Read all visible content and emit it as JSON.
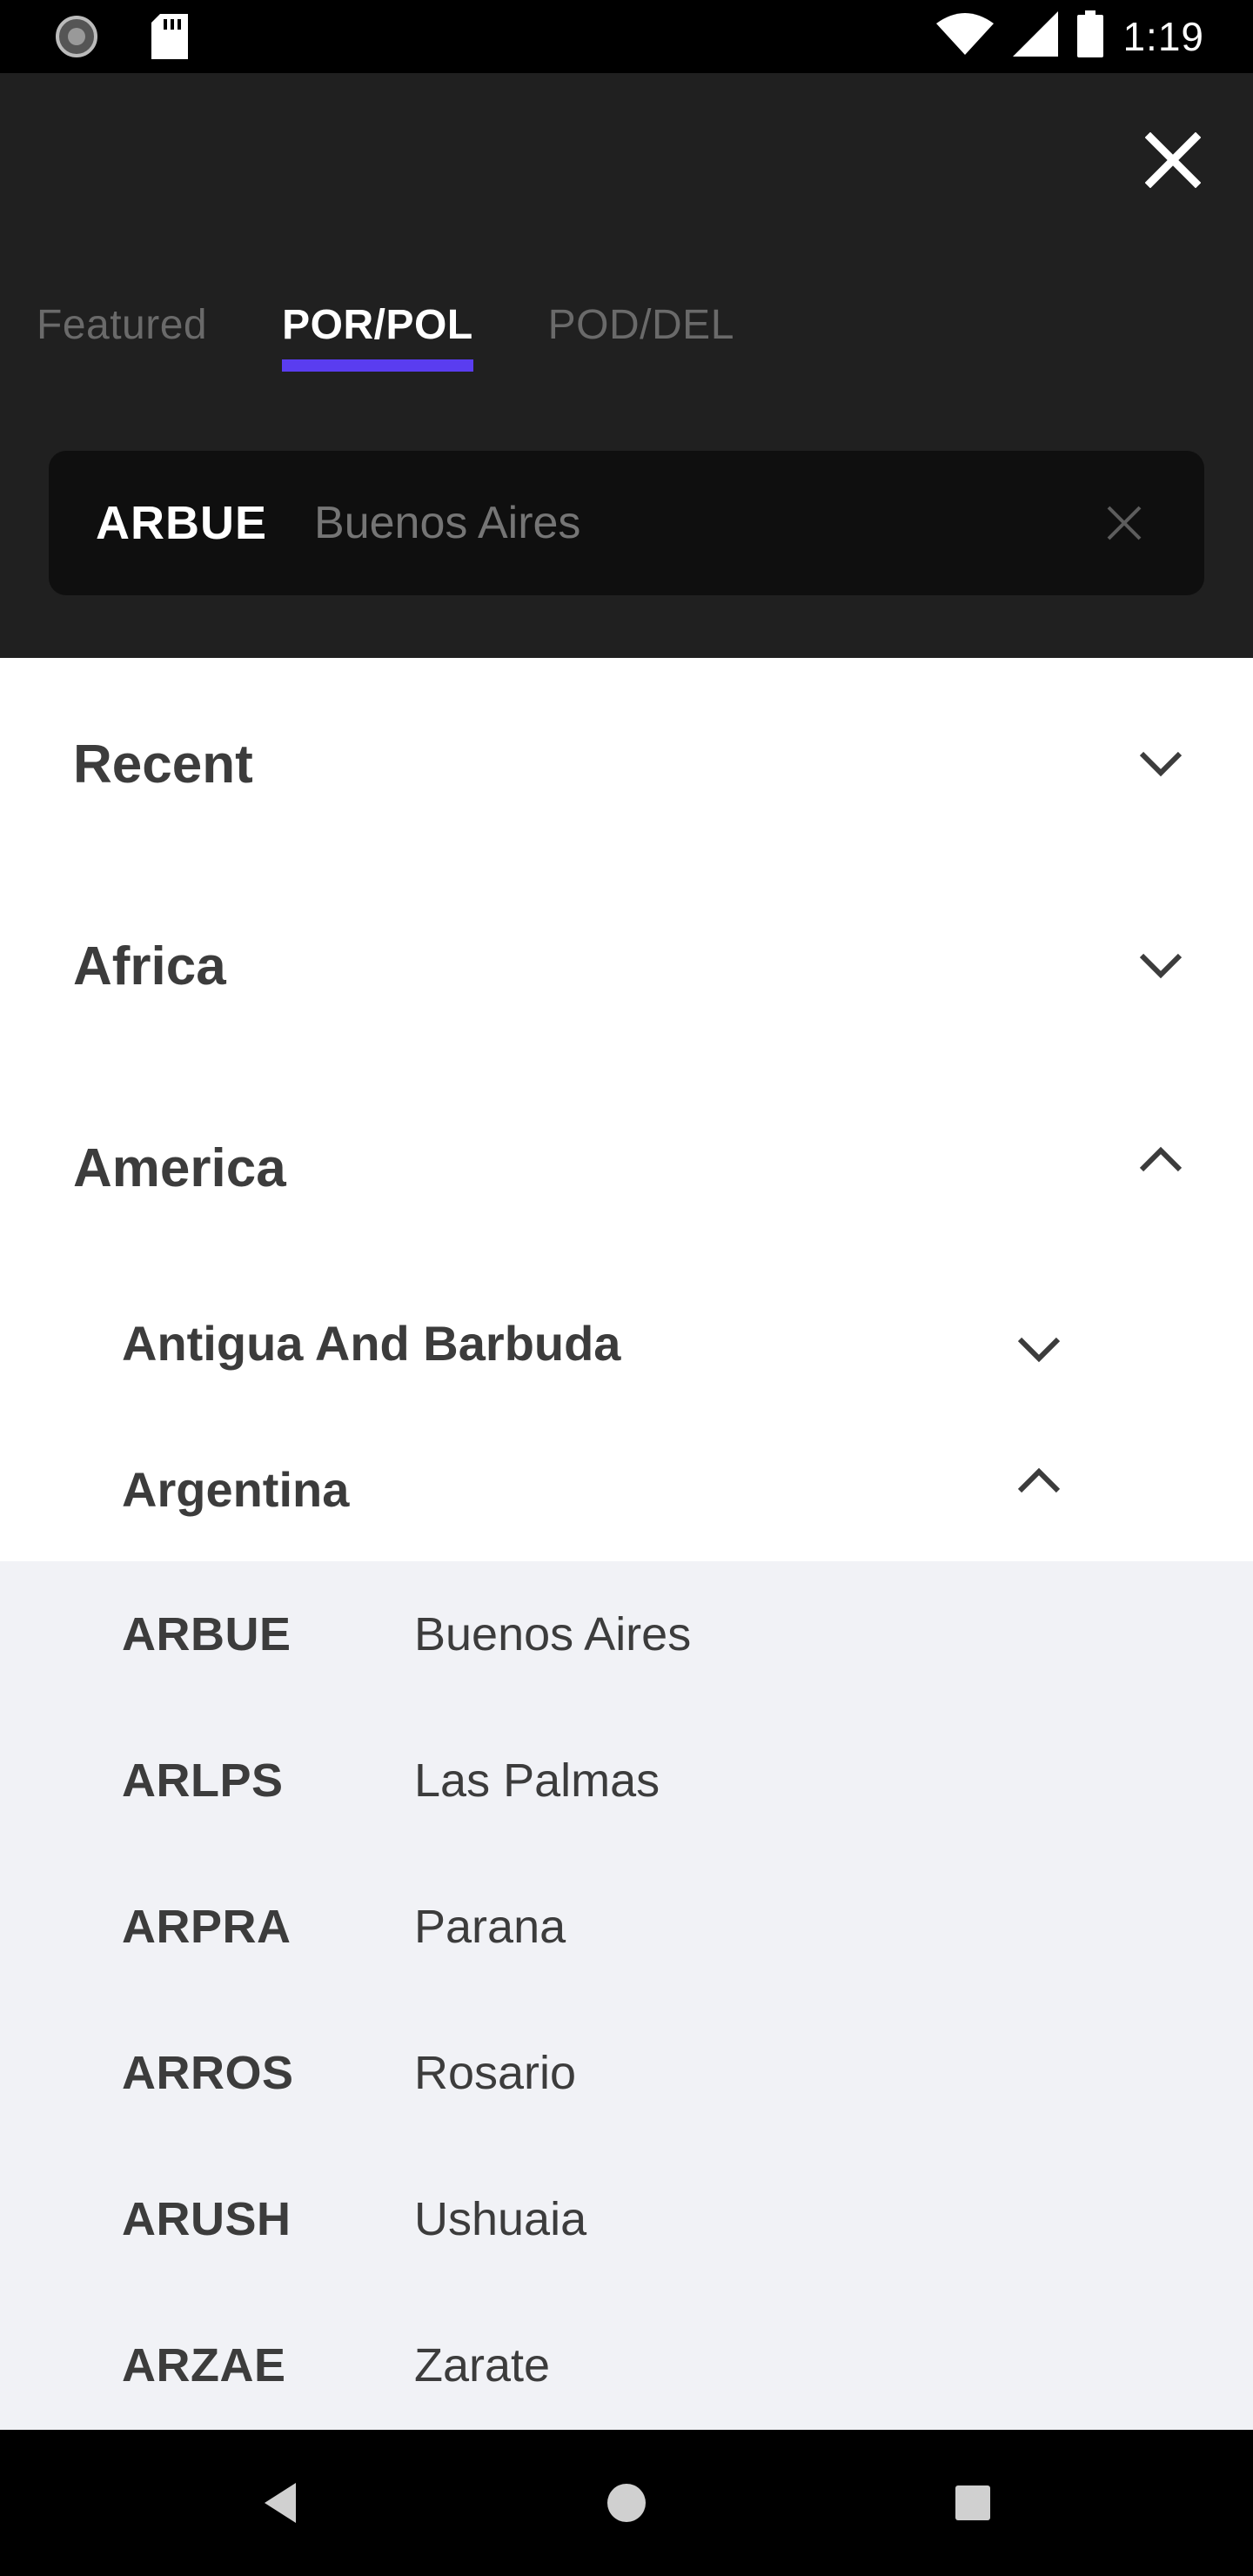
{
  "status_bar": {
    "time": "1:19",
    "icons": [
      "spinner-icon",
      "sd-card-icon",
      "wifi-icon",
      "signal-icon",
      "battery-icon"
    ]
  },
  "header": {
    "close_icon": "close-icon",
    "tabs": [
      {
        "label": "Featured",
        "active": false
      },
      {
        "label": "POR/POL",
        "active": true
      },
      {
        "label": "POD/DEL",
        "active": false
      }
    ],
    "search": {
      "code": "ARBUE",
      "value": "",
      "placeholder": "Buenos Aires"
    },
    "accent_color": "#5a3df0"
  },
  "sections": [
    {
      "title": "Recent",
      "expanded": false
    },
    {
      "title": "Africa",
      "expanded": false
    },
    {
      "title": "America",
      "expanded": true
    }
  ],
  "sub_sections": [
    {
      "title": "Antigua And Barbuda",
      "expanded": false
    },
    {
      "title": "Argentina",
      "expanded": true
    }
  ],
  "ports": [
    {
      "code": "ARBUE",
      "name": "Buenos Aires"
    },
    {
      "code": "ARLPS",
      "name": "Las Palmas"
    },
    {
      "code": "ARPRA",
      "name": "Parana"
    },
    {
      "code": "ARROS",
      "name": "Rosario"
    },
    {
      "code": "ARUSH",
      "name": "Ushuaia"
    },
    {
      "code": "ARZAE",
      "name": "Zarate"
    }
  ],
  "nav_bar": {
    "icons": [
      "back-icon",
      "home-icon",
      "recents-icon"
    ]
  }
}
